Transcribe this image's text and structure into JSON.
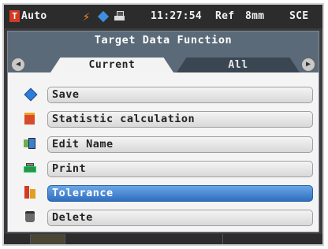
{
  "statusbar": {
    "mode_letter": "T",
    "mode": "Auto",
    "time": "11:27:54",
    "ref": "Ref",
    "aperture": "8mm",
    "specular": "SCE"
  },
  "dialog": {
    "title": "Target Data Function",
    "tabs": [
      {
        "label": "Current",
        "active": true
      },
      {
        "label": "All",
        "active": false
      }
    ]
  },
  "menu": [
    {
      "label": "Save",
      "icon": "save-icon",
      "selected": false
    },
    {
      "label": "Statistic calculation",
      "icon": "statistics-icon",
      "selected": false
    },
    {
      "label": "Edit Name",
      "icon": "edit-name-icon",
      "selected": false
    },
    {
      "label": "Print",
      "icon": "print-icon",
      "selected": false
    },
    {
      "label": "Tolerance",
      "icon": "tolerance-icon",
      "selected": true
    },
    {
      "label": "Delete",
      "icon": "delete-icon",
      "selected": false
    }
  ],
  "colors": {
    "accent_selected": "#2f6fc0",
    "panel": "#5a6a78",
    "mode_badge": "#d43a24"
  }
}
